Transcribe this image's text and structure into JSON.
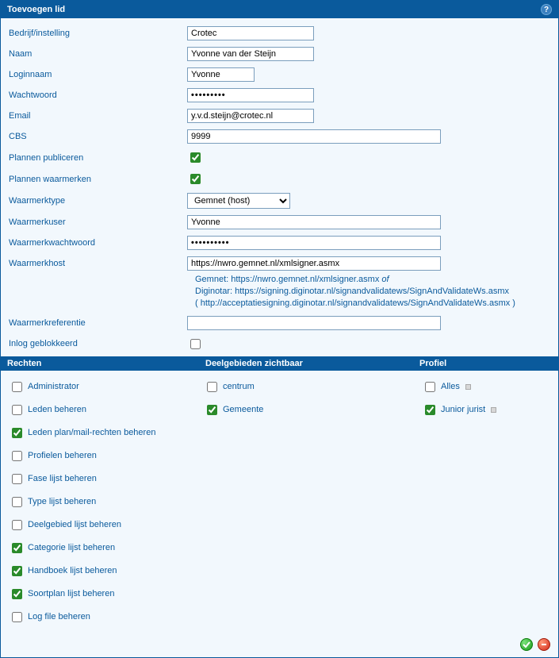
{
  "header": {
    "title": "Toevoegen lid"
  },
  "form": {
    "bedrijf": {
      "label": "Bedrijf/instelling",
      "value": "Crotec"
    },
    "naam": {
      "label": "Naam",
      "value": "Yvonne van der Steijn"
    },
    "loginnaam": {
      "label": "Loginnaam",
      "value": "Yvonne"
    },
    "wachtwoord": {
      "label": "Wachtwoord",
      "value": "•••••••••"
    },
    "email": {
      "label": "Email",
      "value": "y.v.d.steijn@crotec.nl"
    },
    "cbs": {
      "label": "CBS",
      "value": "9999"
    },
    "plannen_publiceren": {
      "label": "Plannen publiceren",
      "checked": true
    },
    "plannen_waarmerken": {
      "label": "Plannen waarmerken",
      "checked": true
    },
    "waarmerktype": {
      "label": "Waarmerktype",
      "value": "Gemnet (host)"
    },
    "waarmerkuser": {
      "label": "Waarmerkuser",
      "value": "Yvonne"
    },
    "waarmerkwachtwoord": {
      "label": "Waarmerkwachtwoord",
      "value": "••••••••••"
    },
    "waarmerkhost": {
      "label": "Waarmerkhost",
      "value": "https://nwro.gemnet.nl/xmlsigner.asmx"
    },
    "waarmerkhost_hint_l1a": "Gemnet: https://nwro.gemnet.nl/xmlsigner.asmx ",
    "waarmerkhost_hint_l1b": "of",
    "waarmerkhost_hint_l2": "Diginotar: https://signing.diginotar.nl/signandvalidatews/SignAndValidateWs.asmx",
    "waarmerkhost_hint_l3": "( http://acceptatiesigning.diginotar.nl/signandvalidatews/SignAndValidateWs.asmx )",
    "waarmerkreferentie": {
      "label": "Waarmerkreferentie",
      "value": ""
    },
    "inlog_geblokkeerd": {
      "label": "Inlog geblokkeerd",
      "checked": false
    }
  },
  "sections": {
    "rechten": "Rechten",
    "deelgebieden": "Deelgebieden zichtbaar",
    "profiel": "Profiel"
  },
  "rechten": [
    {
      "label": "Administrator",
      "checked": false
    },
    {
      "label": "Leden beheren",
      "checked": false
    },
    {
      "label": "Leden plan/mail-rechten beheren",
      "checked": true
    },
    {
      "label": "Profielen beheren",
      "checked": false
    },
    {
      "label": "Fase lijst beheren",
      "checked": false
    },
    {
      "label": "Type lijst beheren",
      "checked": false
    },
    {
      "label": "Deelgebied lijst beheren",
      "checked": false
    },
    {
      "label": "Categorie lijst beheren",
      "checked": true
    },
    {
      "label": "Handboek lijst beheren",
      "checked": true
    },
    {
      "label": "Soortplan lijst beheren",
      "checked": true
    },
    {
      "label": "Log file beheren",
      "checked": false
    }
  ],
  "deelgebieden": [
    {
      "label": "centrum",
      "checked": false
    },
    {
      "label": "Gemeente",
      "checked": true
    }
  ],
  "profiel": [
    {
      "label": "Alles",
      "checked": false
    },
    {
      "label": "Junior jurist",
      "checked": true
    }
  ]
}
